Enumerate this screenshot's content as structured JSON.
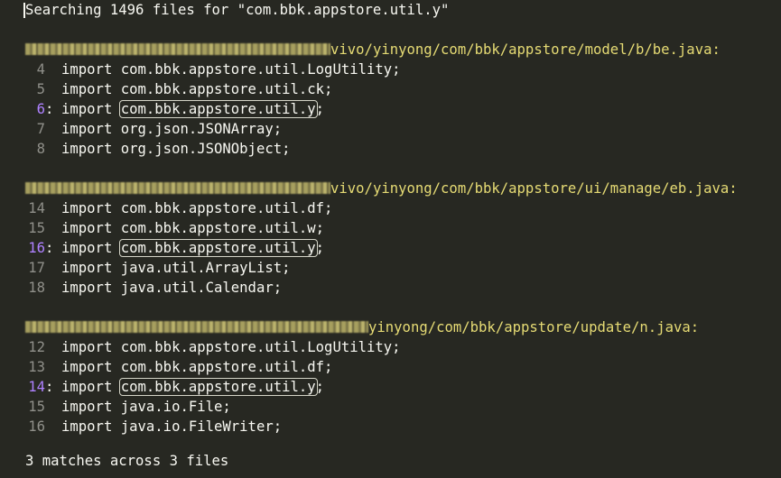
{
  "search": {
    "header": "Searching 1496 files for \"com.bbk.appstore.util.y\"",
    "query": "com.bbk.appstore.util.y"
  },
  "files": [
    {
      "path_visible": "vivo/yinyong/com/bbk/appstore/model/b/be.java:",
      "lines": [
        {
          "num": "4",
          "colon": " ",
          "is_match": false,
          "kw": "import",
          "pre": "com.bbk.appstore.util.LogUtility;",
          "match": "",
          "post": ""
        },
        {
          "num": "5",
          "colon": " ",
          "is_match": false,
          "kw": "import",
          "pre": "com.bbk.appstore.util.ck;",
          "match": "",
          "post": ""
        },
        {
          "num": "6",
          "colon": ":",
          "is_match": true,
          "kw": "import",
          "pre": "",
          "match": "com.bbk.appstore.util.y",
          "post": ";"
        },
        {
          "num": "7",
          "colon": " ",
          "is_match": false,
          "kw": "import",
          "pre": "org.json.JSONArray;",
          "match": "",
          "post": ""
        },
        {
          "num": "8",
          "colon": " ",
          "is_match": false,
          "kw": "import",
          "pre": "org.json.JSONObject;",
          "match": "",
          "post": ""
        }
      ]
    },
    {
      "path_visible": "vivo/yinyong/com/bbk/appstore/ui/manage/eb.java:",
      "lines": [
        {
          "num": "14",
          "colon": " ",
          "is_match": false,
          "kw": "import",
          "pre": "com.bbk.appstore.util.df;",
          "match": "",
          "post": ""
        },
        {
          "num": "15",
          "colon": " ",
          "is_match": false,
          "kw": "import",
          "pre": "com.bbk.appstore.util.w;",
          "match": "",
          "post": ""
        },
        {
          "num": "16",
          "colon": ":",
          "is_match": true,
          "kw": "import",
          "pre": "",
          "match": "com.bbk.appstore.util.y",
          "post": ";"
        },
        {
          "num": "17",
          "colon": " ",
          "is_match": false,
          "kw": "import",
          "pre": "java.util.ArrayList;",
          "match": "",
          "post": ""
        },
        {
          "num": "18",
          "colon": " ",
          "is_match": false,
          "kw": "import",
          "pre": "java.util.Calendar;",
          "match": "",
          "post": ""
        }
      ]
    },
    {
      "path_visible": "yinyong/com/bbk/appstore/update/n.java:",
      "lines": [
        {
          "num": "12",
          "colon": " ",
          "is_match": false,
          "kw": "import",
          "pre": "com.bbk.appstore.util.LogUtility;",
          "match": "",
          "post": ""
        },
        {
          "num": "13",
          "colon": " ",
          "is_match": false,
          "kw": "import",
          "pre": "com.bbk.appstore.util.df;",
          "match": "",
          "post": ""
        },
        {
          "num": "14",
          "colon": ":",
          "is_match": true,
          "kw": "import",
          "pre": "",
          "match": "com.bbk.appstore.util.y",
          "post": ";"
        },
        {
          "num": "15",
          "colon": " ",
          "is_match": false,
          "kw": "import",
          "pre": "java.io.File;",
          "match": "",
          "post": ""
        },
        {
          "num": "16",
          "colon": " ",
          "is_match": false,
          "kw": "import",
          "pre": "java.io.FileWriter;",
          "match": "",
          "post": ""
        }
      ]
    }
  ],
  "summary": "3 matches across 3 files",
  "colors": {
    "background": "#272822",
    "text": "#f8f8f2",
    "path": "#e6db74",
    "match_line_number": "#ae81ff",
    "line_number": "#90908a"
  }
}
